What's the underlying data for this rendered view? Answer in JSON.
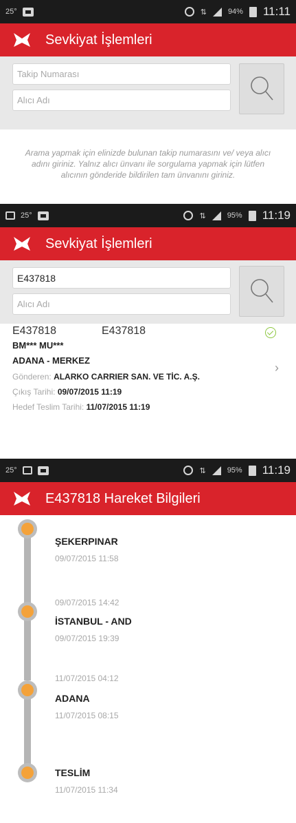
{
  "screen1": {
    "status": {
      "left_text": "25°",
      "right_text": "94%",
      "clock": "11:11"
    },
    "appbar": {
      "title": "Sevkiyat İşlemleri"
    },
    "search": {
      "tracking_placeholder": "Takip Numarası",
      "receiver_placeholder": "Alıcı Adı"
    },
    "info_text": "Arama yapmak için elinizde bulunan takip numarasını ve/ veya alıcı adını giriniz. Yalnız alıcı ünvanı ile sorgulama yapmak için lütfen alıcının gönderide bildirilen tam ünvanını giriniz."
  },
  "screen2": {
    "status": {
      "left_text": "25°",
      "right_text": "95%",
      "clock": "11:19"
    },
    "appbar": {
      "title": "Sevkiyat İşlemleri"
    },
    "search": {
      "tracking_value": "E437818",
      "receiver_placeholder": "Alıcı Adı"
    },
    "result": {
      "id_1": "E437818",
      "id_2": "E437818",
      "receiver": "BM*** MU***",
      "branch": "ADANA - MERKEZ",
      "sender_label": "Gönderen:",
      "sender_value": "ALARKO CARRIER SAN. VE TİC. A.Ş.",
      "exit_label": "Çıkış Tarihi:",
      "exit_value": "09/07/2015 11:19",
      "target_label": "Hedef Teslim Tarihi:",
      "target_value": "11/07/2015 11:19"
    }
  },
  "screen3": {
    "status": {
      "left_text": "25°",
      "right_text": "95%",
      "clock": "11:19"
    },
    "appbar": {
      "title": "E437818 Hareket Bilgileri"
    },
    "events": [
      {
        "before": "",
        "location": "ŞEKERPINAR",
        "after": "09/07/2015 11:58"
      },
      {
        "before": "09/07/2015 14:42",
        "location": "İSTANBUL - AND",
        "after": "09/07/2015 19:39"
      },
      {
        "before": "11/07/2015 04:12",
        "location": "ADANA",
        "after": "11/07/2015 08:15"
      },
      {
        "before": "",
        "location": "TESLİM",
        "after": "11/07/2015 11:34"
      }
    ]
  },
  "colors": {
    "brand_red": "#d9232b",
    "timeline_orange": "#f4a23a",
    "check_green": "#8cc63f"
  },
  "icons": [
    "app-logo-icon",
    "search-icon",
    "check-icon",
    "chevron-right-icon",
    "alarm-icon",
    "signal-icon",
    "battery-icon",
    "bag-icon"
  ]
}
